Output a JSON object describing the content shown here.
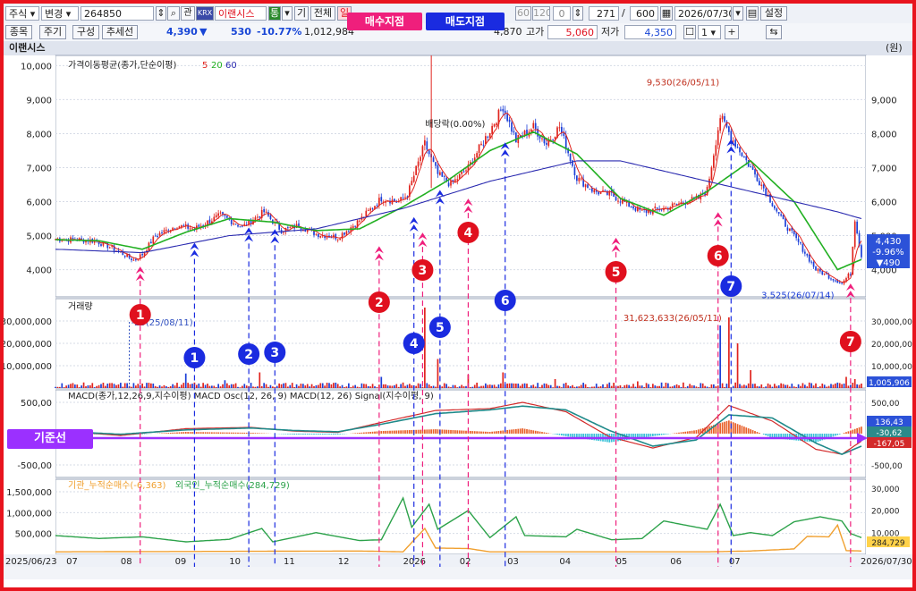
{
  "toolbar": {
    "market": "주식",
    "mode": "변경",
    "code": "264850",
    "krx_badge": "KRX",
    "name": "이랜시스",
    "tong": "통",
    "gi": "기",
    "all": "전체",
    "il": "일",
    "count_a": "271",
    "slash": "/",
    "count_b": "600",
    "date": "2026/07/30",
    "settings": "설정",
    "periods": [
      "60",
      "120"
    ],
    "spin_val": "0"
  },
  "toolbar2": {
    "jongmok": "종목",
    "jugi": "주기",
    "guseong": "구성",
    "chuse": "추세선",
    "price": "4,390",
    "down_arrow": "▼",
    "change": "530",
    "change_pct": "-10.77%",
    "volume": "1,012,984",
    "open_val": "4,870",
    "high_label": "고가",
    "high_val": "5,060",
    "low_label": "저가",
    "low_val": "4,350",
    "spin": "1"
  },
  "banners": {
    "buy": "매수지점",
    "sell": "매도지점",
    "baseline": "기준선"
  },
  "panel_title": "이랜시스",
  "unit": "(원)",
  "colors": {
    "candle_up": "#e0241e",
    "candle_down": "#1c3fd8",
    "ma5": "#e0241e",
    "ma20": "#22b022",
    "ma60": "#2b2bb0",
    "buy": "#ef1f7c",
    "sell": "#1a2be0",
    "macd": "#d32a2a",
    "signal": "#1f8a8a",
    "inst": "#f0a030",
    "foreign": "#2ca24a",
    "baseline": "#9b30ff"
  },
  "chart_data": {
    "type": "candlestick",
    "x_labels": [
      "2025/06/23",
      "07",
      "08",
      "09",
      "10",
      "11",
      "12",
      "2026",
      "02",
      "03",
      "04",
      "05",
      "06",
      "07",
      "2026/07/30"
    ],
    "price_panel": {
      "legend": {
        "name": "가격이동평균(종가,단순이평)",
        "periods": [
          "5",
          "20",
          "60"
        ]
      },
      "ylim": [
        3200,
        10300
      ],
      "y_ticks": [
        4000,
        5000,
        6000,
        7000,
        8000,
        9000,
        10000
      ],
      "y_tick_labels": [
        "4,000",
        "5,000",
        "6,000",
        "7,000",
        "8,000",
        "9,000",
        "10,000"
      ],
      "y_tick_labels_right": [
        "4,000",
        "5,000",
        "6,000",
        "7,000",
        "8,000",
        "9,000"
      ],
      "close_anchors": [
        [
          0,
          4900
        ],
        [
          10,
          4880
        ],
        [
          18,
          4850
        ],
        [
          24,
          4700
        ],
        [
          30,
          4500
        ],
        [
          36,
          4280
        ],
        [
          40,
          4450
        ],
        [
          46,
          5000
        ],
        [
          56,
          5300
        ],
        [
          64,
          5200
        ],
        [
          76,
          5600
        ],
        [
          86,
          5250
        ],
        [
          96,
          5700
        ],
        [
          104,
          5150
        ],
        [
          112,
          5300
        ],
        [
          120,
          5050
        ],
        [
          130,
          4950
        ],
        [
          140,
          5450
        ],
        [
          150,
          6100
        ],
        [
          158,
          6000
        ],
        [
          162,
          6200
        ],
        [
          170,
          7700
        ],
        [
          176,
          6800
        ],
        [
          182,
          6500
        ],
        [
          190,
          7000
        ],
        [
          200,
          8100
        ],
        [
          206,
          8800
        ],
        [
          212,
          7800
        ],
        [
          220,
          8200
        ],
        [
          226,
          7700
        ],
        [
          232,
          8200
        ],
        [
          240,
          6700
        ],
        [
          248,
          6300
        ],
        [
          256,
          6200
        ],
        [
          264,
          5900
        ],
        [
          270,
          5700
        ],
        [
          280,
          5800
        ],
        [
          290,
          6000
        ],
        [
          296,
          6100
        ],
        [
          300,
          6350
        ],
        [
          306,
          8500
        ],
        [
          312,
          7800
        ],
        [
          318,
          7200
        ],
        [
          326,
          6400
        ],
        [
          334,
          5500
        ],
        [
          342,
          4800
        ],
        [
          350,
          4000
        ],
        [
          356,
          3800
        ],
        [
          362,
          3600
        ],
        [
          366,
          3900
        ],
        [
          368,
          5500
        ],
        [
          371,
          4390
        ]
      ],
      "ma20_anchors": [
        [
          20,
          4850
        ],
        [
          40,
          4600
        ],
        [
          60,
          5100
        ],
        [
          80,
          5500
        ],
        [
          100,
          5400
        ],
        [
          120,
          5150
        ],
        [
          140,
          5200
        ],
        [
          160,
          5850
        ],
        [
          180,
          6600
        ],
        [
          200,
          7500
        ],
        [
          220,
          8050
        ],
        [
          240,
          7400
        ],
        [
          260,
          6100
        ],
        [
          280,
          5600
        ],
        [
          300,
          6300
        ],
        [
          320,
          7200
        ],
        [
          340,
          6000
        ],
        [
          360,
          4000
        ],
        [
          371,
          4300
        ]
      ],
      "ma60_anchors": [
        [
          0,
          4600
        ],
        [
          40,
          4500
        ],
        [
          80,
          5000
        ],
        [
          120,
          5200
        ],
        [
          160,
          5800
        ],
        [
          200,
          6600
        ],
        [
          240,
          7200
        ],
        [
          260,
          7200
        ],
        [
          280,
          6900
        ],
        [
          300,
          6600
        ],
        [
          320,
          6300
        ],
        [
          340,
          6000
        ],
        [
          360,
          5700
        ],
        [
          371,
          5500
        ]
      ],
      "annotations": [
        {
          "text": "9,530(26/05/11)",
          "x": 310,
          "y": 9530
        },
        {
          "text": "3,525(26/07/14)",
          "x": 362,
          "y": 3525
        },
        {
          "text": "배당락(0.00%)",
          "x": 185,
          "y": 8200
        }
      ],
      "current": {
        "price": "4,430",
        "pct": "-9.96%",
        "diff": "▼490"
      }
    },
    "volume_panel": {
      "legend": "거래량",
      "ylim": [
        0,
        40000000
      ],
      "y_ticks": [
        10000000,
        20000000,
        30000000
      ],
      "y_tick_labels": [
        "10,000,000",
        "20,000,000",
        "30,000,000"
      ],
      "y_tick_labels_right": [
        "10,000,000",
        "20,000,000",
        "30,000,000"
      ],
      "peak_annotation": {
        "text": "31,623,633(26/05/11)",
        "x": 310,
        "y": 31623633
      },
      "left_annotation": {
        "text": "-25(25/08/11)",
        "x": 34,
        "y": 28000000
      },
      "current": "1,005,906",
      "spikes": [
        [
          60,
          6500000
        ],
        [
          78,
          3500000
        ],
        [
          94,
          7000000
        ],
        [
          150,
          5000000
        ],
        [
          170,
          36000000
        ],
        [
          176,
          13000000
        ],
        [
          190,
          6000000
        ],
        [
          206,
          7000000
        ],
        [
          230,
          4000000
        ],
        [
          268,
          3000000
        ],
        [
          306,
          28000000
        ],
        [
          310,
          31623633
        ],
        [
          314,
          20000000
        ],
        [
          320,
          8000000
        ],
        [
          364,
          5000000
        ],
        [
          368,
          4000000
        ]
      ]
    },
    "macd_panel": {
      "legend": "MACD(종가,12,26,9,지수이평) MACD Osc(12, 26, 9) MACD(12, 26) Signal(지수이평, 9)",
      "ylim": [
        -700,
        700
      ],
      "y_ticks": [
        -500,
        500
      ],
      "y_tick_labels": [
        "-500,00",
        "500,00"
      ],
      "y_tick_labels_right": [
        "-500,00",
        "500,00"
      ],
      "current": [
        "136,43",
        "-30,62",
        "-167,05"
      ],
      "macd_anchors": [
        [
          0,
          50
        ],
        [
          30,
          -30
        ],
        [
          60,
          80
        ],
        [
          90,
          100
        ],
        [
          110,
          40
        ],
        [
          130,
          20
        ],
        [
          150,
          180
        ],
        [
          175,
          370
        ],
        [
          200,
          400
        ],
        [
          215,
          500
        ],
        [
          235,
          350
        ],
        [
          255,
          -50
        ],
        [
          275,
          -230
        ],
        [
          295,
          -60
        ],
        [
          310,
          450
        ],
        [
          330,
          200
        ],
        [
          350,
          -250
        ],
        [
          362,
          -330
        ],
        [
          371,
          -120
        ]
      ],
      "signal_anchors": [
        [
          0,
          40
        ],
        [
          30,
          -10
        ],
        [
          60,
          60
        ],
        [
          90,
          90
        ],
        [
          110,
          50
        ],
        [
          130,
          30
        ],
        [
          150,
          150
        ],
        [
          175,
          320
        ],
        [
          200,
          380
        ],
        [
          215,
          440
        ],
        [
          235,
          380
        ],
        [
          255,
          50
        ],
        [
          275,
          -200
        ],
        [
          295,
          -100
        ],
        [
          310,
          300
        ],
        [
          330,
          250
        ],
        [
          350,
          -150
        ],
        [
          362,
          -330
        ],
        [
          371,
          -200
        ]
      ]
    },
    "flow_panel": {
      "legend_inst": "기관_누적순매수(-6,363)",
      "legend_foreign": "외국인_누적순매수(284,729)",
      "ylim_left": [
        0,
        1800000
      ],
      "y_ticks_left": [
        500000,
        1000000,
        1500000
      ],
      "y_tick_labels_left": [
        "500,000",
        "1,000,000",
        "1,500,000"
      ],
      "ylim_right": [
        0,
        34000
      ],
      "y_ticks_right": [
        10000,
        20000,
        30000
      ],
      "y_tick_labels_right": [
        "10,000",
        "20,000",
        "30,000"
      ],
      "current": "284,729",
      "inst_anchors": [
        [
          0,
          60000
        ],
        [
          140,
          80000
        ],
        [
          160,
          60000
        ],
        [
          170,
          620000
        ],
        [
          175,
          150000
        ],
        [
          190,
          140000
        ],
        [
          200,
          60000
        ],
        [
          260,
          60000
        ],
        [
          300,
          60000
        ],
        [
          320,
          80000
        ],
        [
          340,
          130000
        ],
        [
          346,
          430000
        ],
        [
          356,
          420000
        ],
        [
          360,
          700000
        ],
        [
          364,
          90000
        ],
        [
          371,
          80000
        ]
      ],
      "foreign_anchors": [
        [
          0,
          450000
        ],
        [
          20,
          380000
        ],
        [
          40,
          420000
        ],
        [
          60,
          300000
        ],
        [
          80,
          360000
        ],
        [
          95,
          620000
        ],
        [
          100,
          300000
        ],
        [
          120,
          520000
        ],
        [
          140,
          330000
        ],
        [
          150,
          350000
        ],
        [
          160,
          1350000
        ],
        [
          164,
          650000
        ],
        [
          172,
          1200000
        ],
        [
          176,
          600000
        ],
        [
          190,
          1050000
        ],
        [
          200,
          400000
        ],
        [
          212,
          900000
        ],
        [
          216,
          450000
        ],
        [
          235,
          420000
        ],
        [
          240,
          600000
        ],
        [
          256,
          350000
        ],
        [
          270,
          380000
        ],
        [
          280,
          800000
        ],
        [
          300,
          600000
        ],
        [
          306,
          1200000
        ],
        [
          312,
          450000
        ],
        [
          320,
          520000
        ],
        [
          330,
          450000
        ],
        [
          340,
          780000
        ],
        [
          352,
          900000
        ],
        [
          362,
          800000
        ],
        [
          366,
          500000
        ],
        [
          371,
          400000
        ]
      ]
    },
    "signals": {
      "buy": [
        {
          "n": "1",
          "x": 39,
          "y": 4300
        },
        {
          "n": "2",
          "x": 149,
          "y": 4900
        },
        {
          "n": "3",
          "x": 169,
          "y": 5300
        },
        {
          "n": "4",
          "x": 190,
          "y": 6300
        },
        {
          "n": "5",
          "x": 258,
          "y": 5150
        },
        {
          "n": "6",
          "x": 305,
          "y": 5900
        },
        {
          "n": "7",
          "x": 366,
          "y": 3800
        }
      ],
      "sell": [
        {
          "n": "1",
          "x": 64,
          "y": 4950
        },
        {
          "n": "2",
          "x": 89,
          "y": 5400
        },
        {
          "n": "3",
          "x": 101,
          "y": 5350
        },
        {
          "n": "4",
          "x": 165,
          "y": 5700
        },
        {
          "n": "5",
          "x": 177,
          "y": 6500
        },
        {
          "n": "6",
          "x": 207,
          "y": 7900
        },
        {
          "n": "7",
          "x": 311,
          "y": 8000
        }
      ]
    }
  }
}
